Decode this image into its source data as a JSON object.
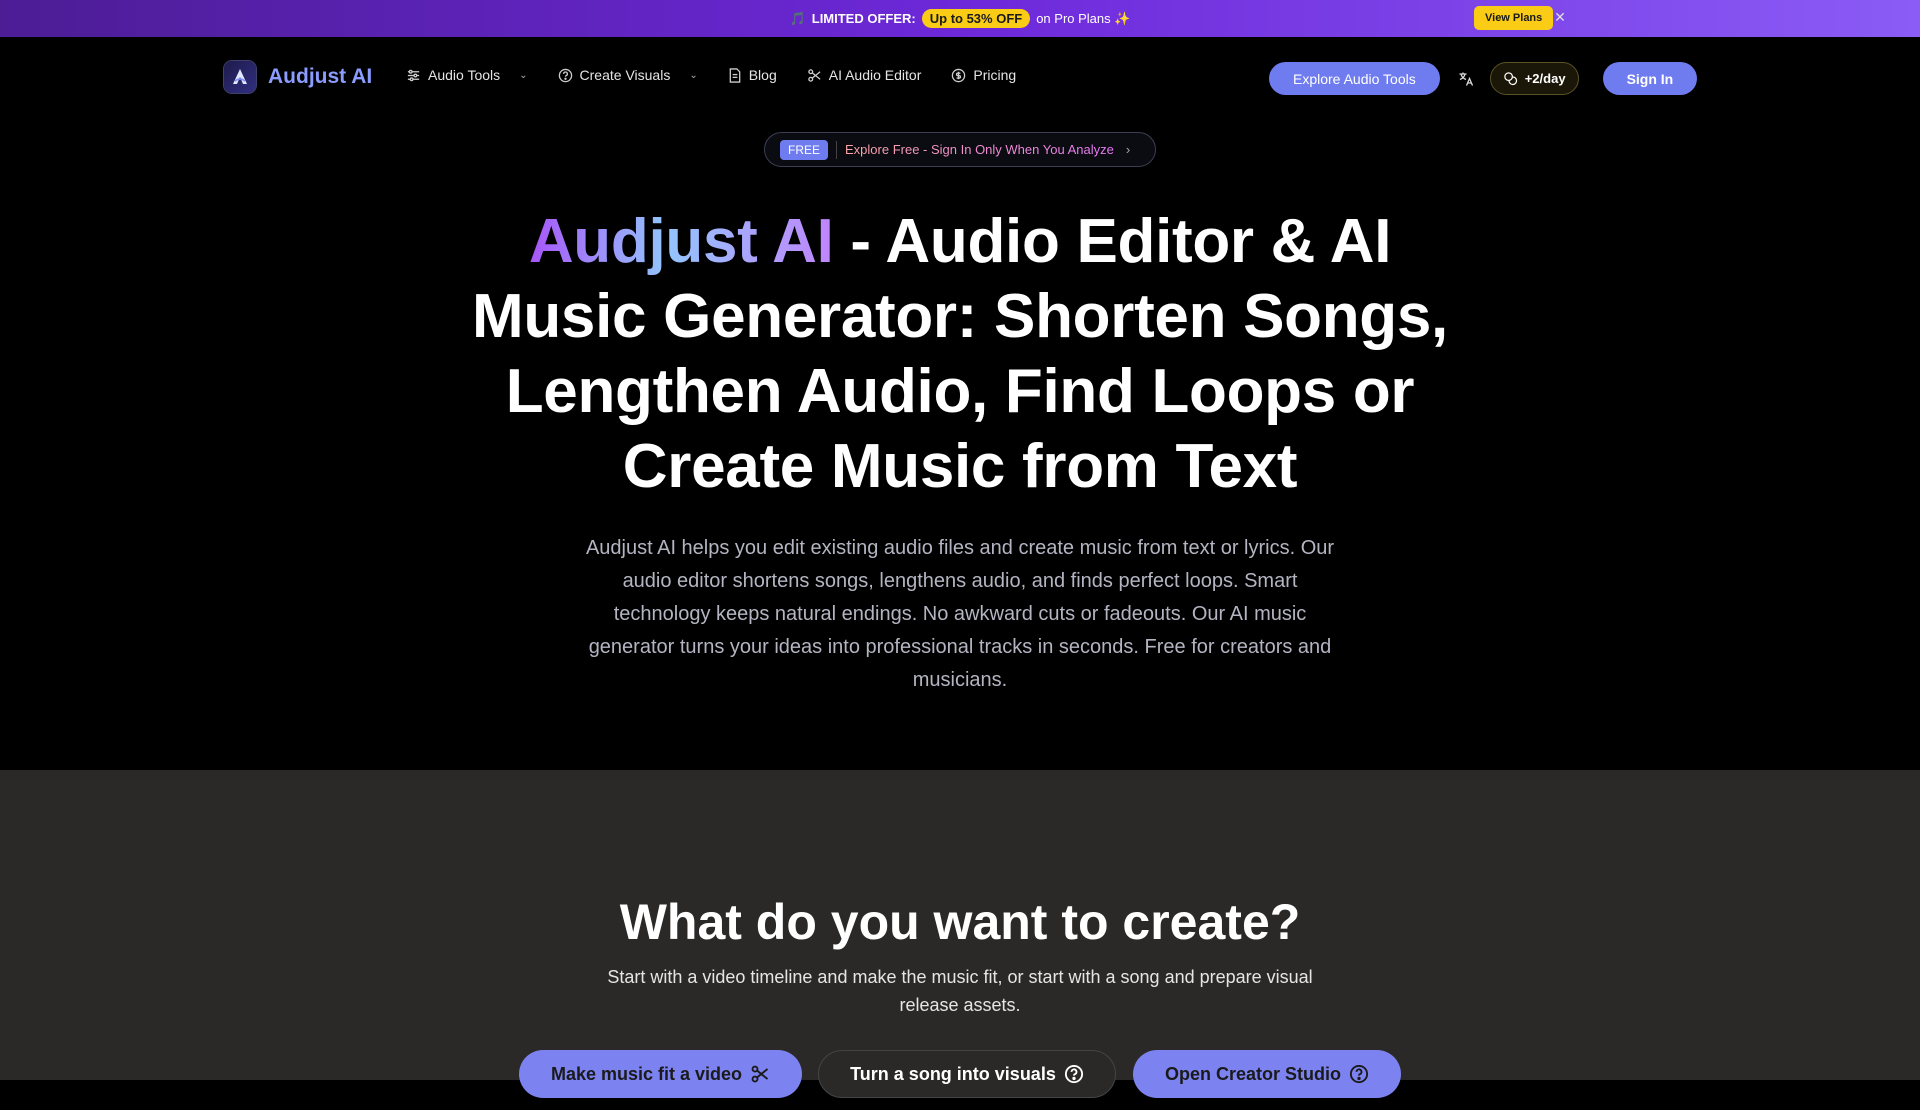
{
  "promo": {
    "emoji": "🎵",
    "label": "LIMITED OFFER:",
    "discount": "Up to 53% OFF",
    "suffix": "on Pro Plans ✨",
    "button": "View Plans",
    "close_icon": "close-icon"
  },
  "nav": {
    "brand": "Audjust AI",
    "items": [
      {
        "label": "Audio Tools",
        "icon": "sliders-icon",
        "has_dropdown": true
      },
      {
        "label": "Create Visuals",
        "icon": "help-circle-icon",
        "has_dropdown": true
      },
      {
        "label": "Blog",
        "icon": "document-icon",
        "has_dropdown": false
      },
      {
        "label": "AI Audio Editor",
        "icon": "scissors-icon",
        "has_dropdown": false
      },
      {
        "label": "Pricing",
        "icon": "dollar-circle-icon",
        "has_dropdown": false
      }
    ],
    "explore_button": "Explore Audio Tools",
    "translate_icon": "translate-icon",
    "credits": "+2/day",
    "signin_button": "Sign In"
  },
  "badge": {
    "tag": "FREE",
    "text": "Explore Free - Sign In Only When You Analyze"
  },
  "hero": {
    "brand": "Audjust AI",
    "title_rest": " - Audio Editor & AI Music Generator: Shorten Songs, Lengthen Audio, Find Loops or Create Music from Text",
    "description": "Audjust AI helps you edit existing audio files and create music from text or lyrics. Our audio editor shortens songs, lengthens audio, and finds perfect loops. Smart technology keeps natural endings. No awkward cuts or fadeouts. Our AI music generator turns your ideas into professional tracks in seconds. Free for creators and musicians."
  },
  "create": {
    "title": "What do you want to create?",
    "subtitle": "Start with a video timeline and make the music fit, or start with a song and prepare visual release assets.",
    "ctas": [
      {
        "label": "Make music fit a video",
        "icon": "scissors-icon"
      },
      {
        "label": "Turn a song into visuals",
        "icon": "help-circle-icon"
      },
      {
        "label": "Open Creator Studio",
        "icon": "help-circle-icon"
      }
    ]
  },
  "colors": {
    "accent": "#6f7cf0",
    "promo_yellow": "#facc15",
    "lower_bg": "#2b2927"
  }
}
